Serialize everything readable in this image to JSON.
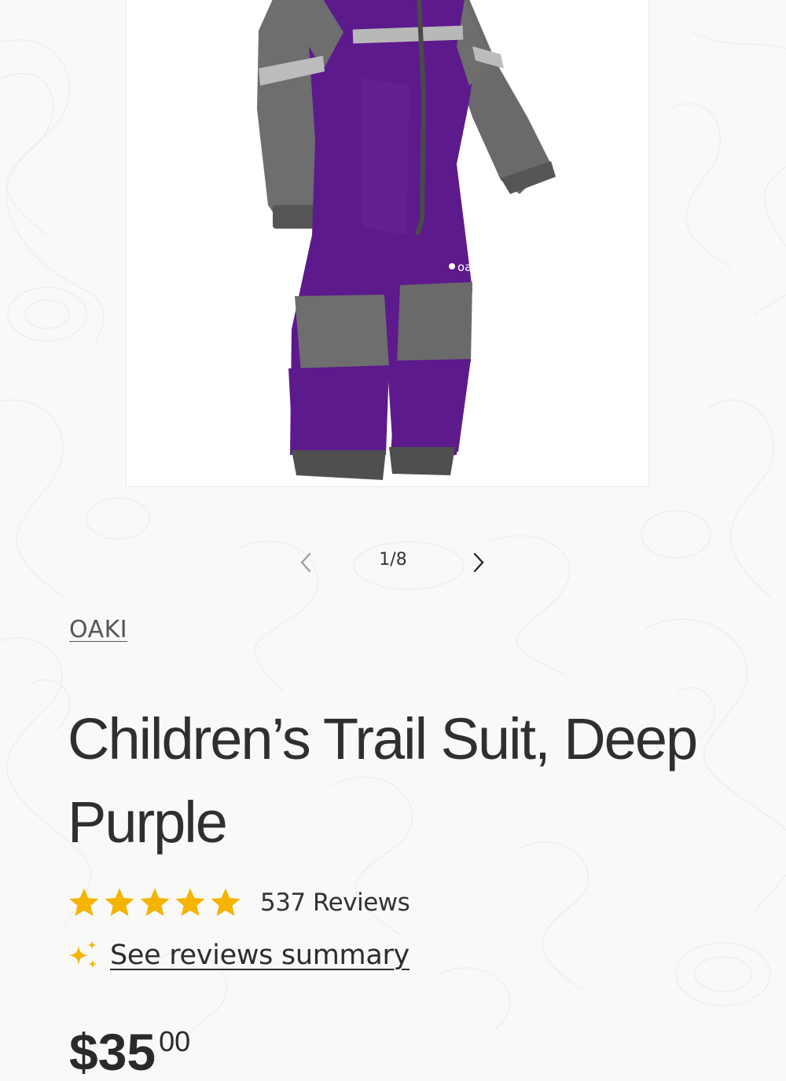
{
  "gallery": {
    "image_alt": "Children's Trail Suit in Deep Purple",
    "garment_logo_text": "oaki",
    "pager": {
      "current": "1/8",
      "prev_icon": "chevron-left-icon",
      "next_icon": "chevron-right-icon"
    }
  },
  "product": {
    "vendor": "OAKI",
    "title": "Children’s Trail Suit, Deep Purple",
    "rating": {
      "stars": 5,
      "max_stars": 5,
      "review_count_label": "537 Reviews",
      "star_color": "#f4b400"
    },
    "summary_link": "See reviews summary",
    "summary_icon": "sparkle-icon",
    "price_main": "$35",
    "price_cents": "00"
  },
  "colors": {
    "background": "#f9f9f8",
    "suit_purple": "#5d1a8c",
    "suit_gray": "#6b6b6b",
    "text": "#2f2f2f",
    "star": "#f4b400"
  }
}
